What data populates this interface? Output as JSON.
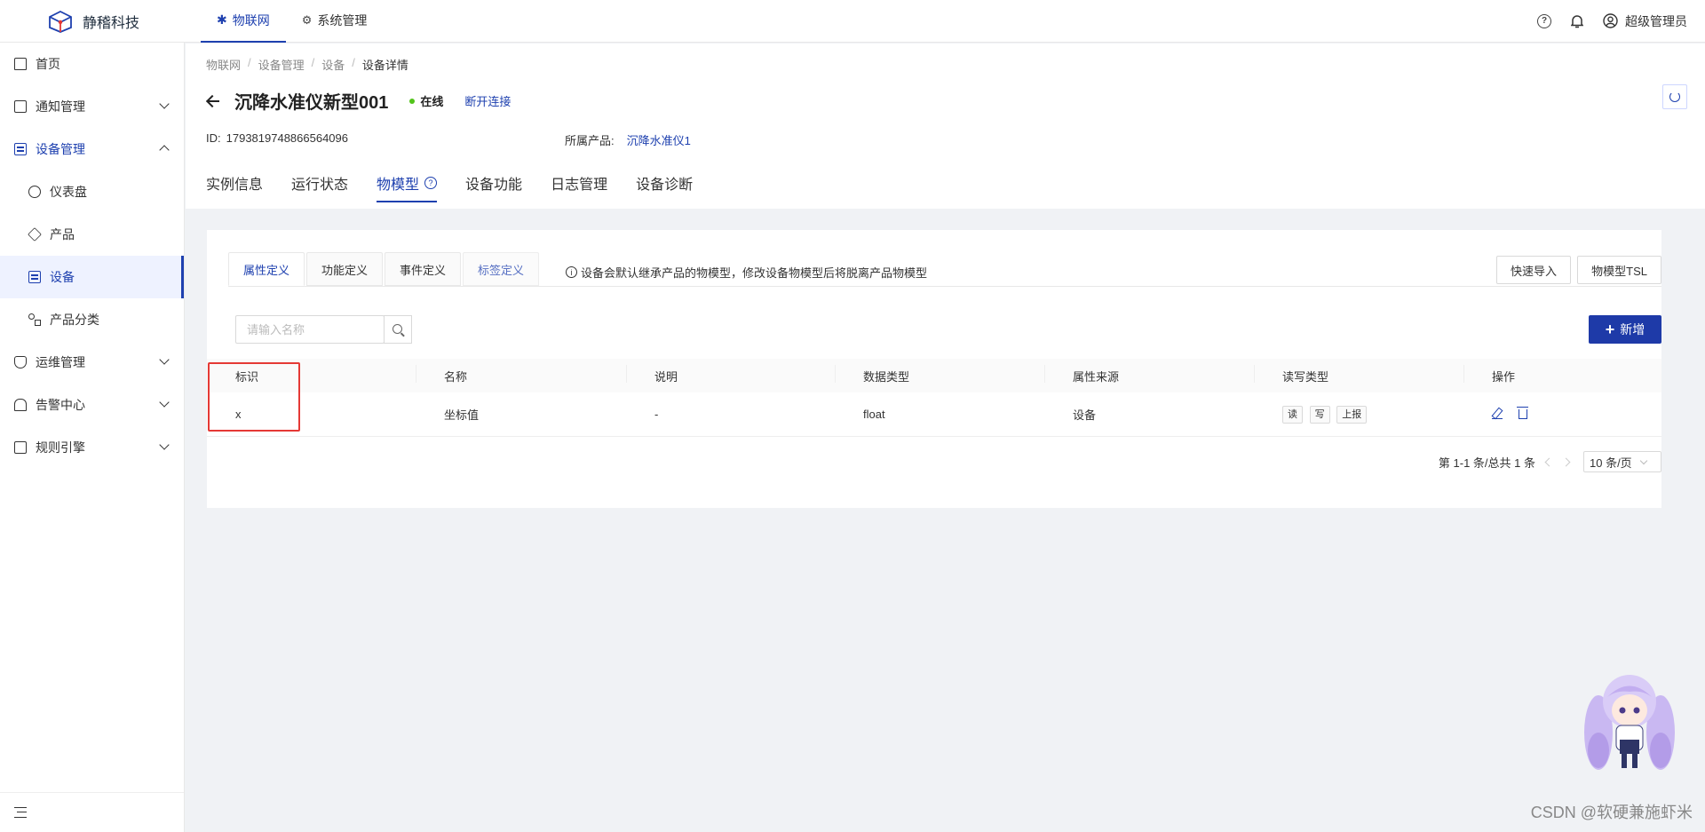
{
  "header": {
    "brand": "静稽科技",
    "nav": [
      {
        "label": "物联网",
        "active": true
      },
      {
        "label": "系统管理",
        "active": false
      }
    ],
    "user": "超级管理员"
  },
  "sidebar": {
    "items": [
      {
        "label": "首页",
        "icon": "home-icon"
      },
      {
        "label": "通知管理",
        "icon": "notice-icon"
      },
      {
        "label": "设备管理",
        "icon": "device-list-icon"
      },
      {
        "label": "仪表盘",
        "icon": "dashboard-icon"
      },
      {
        "label": "产品",
        "icon": "cube-icon"
      },
      {
        "label": "设备",
        "icon": "device-list-icon"
      },
      {
        "label": "产品分类",
        "icon": "category-icon"
      },
      {
        "label": "运维管理",
        "icon": "shield-icon"
      },
      {
        "label": "告警中心",
        "icon": "alarm-icon"
      },
      {
        "label": "规则引擎",
        "icon": "rule-icon"
      }
    ]
  },
  "breadcrumb": [
    "物联网",
    "设备管理",
    "设备",
    "设备详情"
  ],
  "device": {
    "name": "沉降水准仪新型001",
    "status": "在线",
    "disconnect": "断开连接",
    "id_label": "ID:",
    "id": "1793819748866564096",
    "product_label": "所属产品:",
    "product": "沉降水准仪1"
  },
  "main_tabs": [
    "实例信息",
    "运行状态",
    "物模型",
    "设备功能",
    "日志管理",
    "设备诊断"
  ],
  "sub_tabs": [
    "属性定义",
    "功能定义",
    "事件定义",
    "标签定义"
  ],
  "tip": "设备会默认继承产品的物模型，修改设备物模型后将脱离产品物模型",
  "buttons": {
    "quick_import": "快速导入",
    "tsl": "物模型TSL",
    "add": "新增"
  },
  "search": {
    "placeholder": "请输入名称"
  },
  "table": {
    "columns": [
      "标识",
      "名称",
      "说明",
      "数据类型",
      "属性来源",
      "读写类型",
      "操作"
    ],
    "rows": [
      {
        "id": "x",
        "name": "坐标值",
        "desc": "-",
        "type": "float",
        "source": "设备",
        "rw": [
          "读",
          "写",
          "上报"
        ]
      }
    ]
  },
  "pager": {
    "summary": "第 1-1 条/总共 1 条",
    "page_size": "10 条/页"
  },
  "watermark": "CSDN @软硬兼施虾米",
  "colors": {
    "accent": "#1e40af",
    "primary_button": "#1e3aa8",
    "online": "#52c41a",
    "highlight": "#e53935"
  }
}
